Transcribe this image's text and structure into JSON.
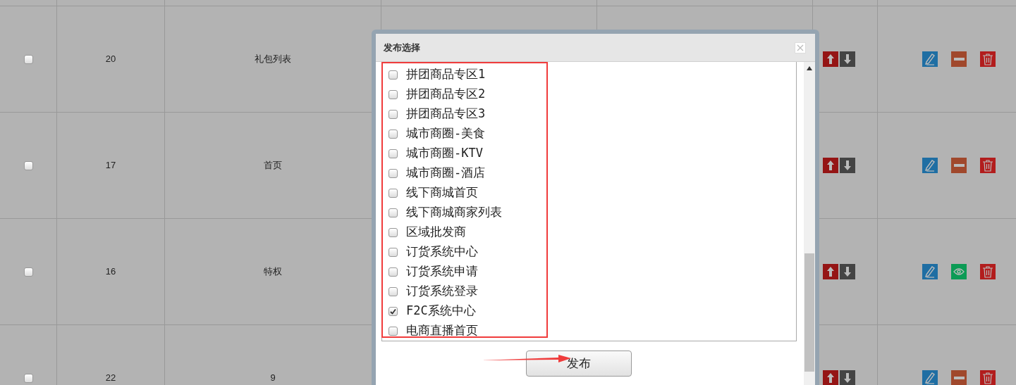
{
  "table": {
    "rows": [
      {
        "checked": false,
        "id": "20",
        "name": "礼包列表",
        "kind": "disable"
      },
      {
        "checked": false,
        "id": "17",
        "name": "首页",
        "kind": "disable"
      },
      {
        "checked": false,
        "id": "16",
        "name": "特权",
        "kind": "enable"
      },
      {
        "checked": false,
        "id": "22",
        "name": "9",
        "kind": "disable"
      }
    ]
  },
  "dialog": {
    "title": "发布选择",
    "items": [
      {
        "label": "拼团商品专区1",
        "checked": false
      },
      {
        "label": "拼团商品专区2",
        "checked": false
      },
      {
        "label": "拼团商品专区3",
        "checked": false
      },
      {
        "label": "城市商圈-美食",
        "checked": false
      },
      {
        "label": "城市商圈-KTV",
        "checked": false
      },
      {
        "label": "城市商圈-酒店",
        "checked": false
      },
      {
        "label": "线下商城首页",
        "checked": false
      },
      {
        "label": "线下商城商家列表",
        "checked": false
      },
      {
        "label": "区域批发商",
        "checked": false
      },
      {
        "label": "订货系统中心",
        "checked": false
      },
      {
        "label": "订货系统申请",
        "checked": false
      },
      {
        "label": "订货系统登录",
        "checked": false
      },
      {
        "label": "F2C系统中心",
        "checked": true
      },
      {
        "label": "电商直播首页",
        "checked": false
      }
    ],
    "button": "发布"
  }
}
